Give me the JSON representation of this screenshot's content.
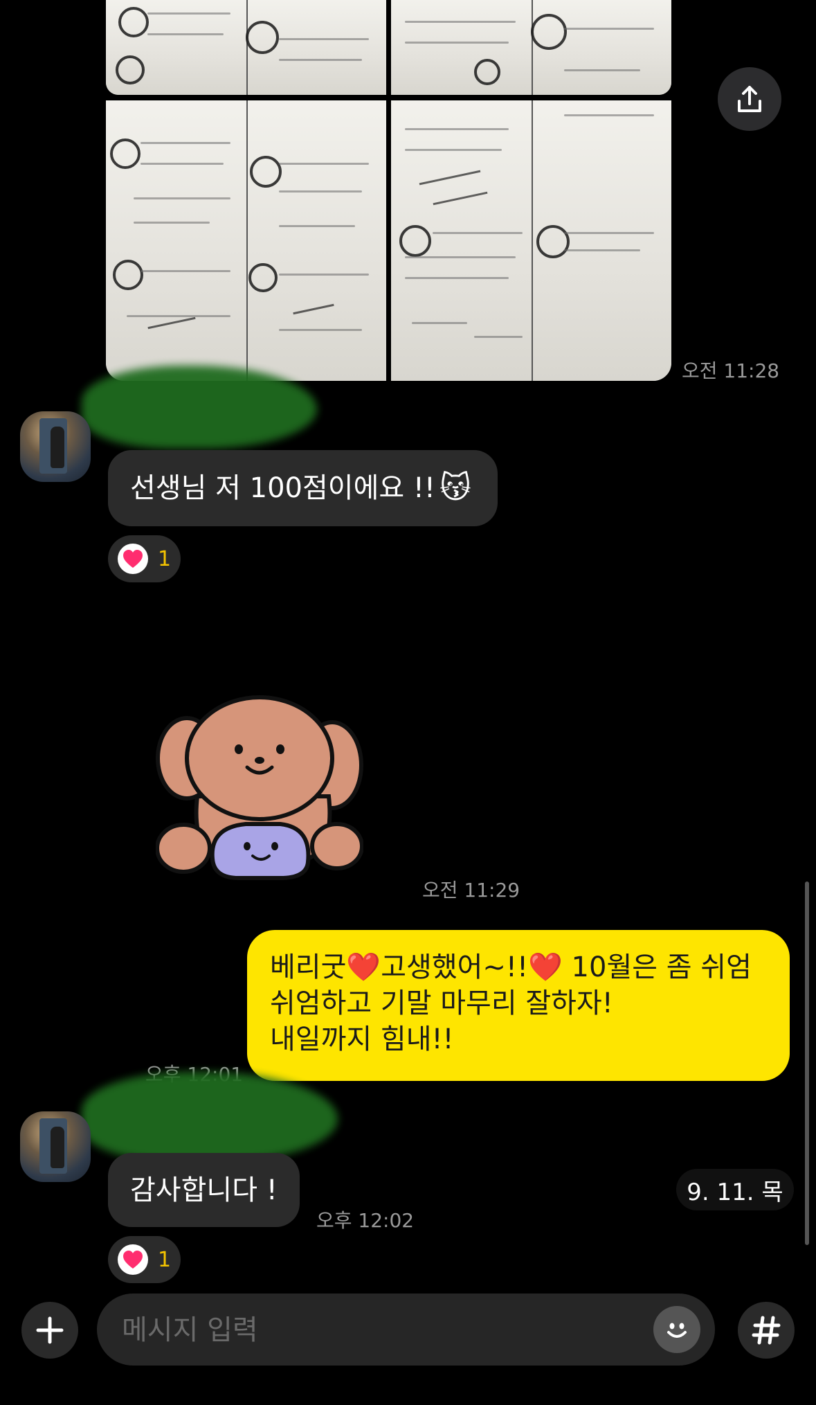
{
  "chat": {
    "messages": [
      {
        "type": "photos",
        "time": "오전 11:28"
      },
      {
        "type": "text",
        "from": "other",
        "text": "선생님 저 100점이에요 !!",
        "emoji": "😽",
        "reaction_count": "1"
      },
      {
        "type": "sticker",
        "from": "other",
        "time": "오전 11:29"
      },
      {
        "type": "text",
        "from": "me",
        "lines": [
          {
            "a": "베리굿",
            "heart1": "❤️",
            "b": "고생했어~!!",
            "heart2": "❤️",
            "c": " 10월은 좀 쉬엄"
          },
          "쉬엄하고 기말 마무리 잘하자!",
          "내일까지 힘내!!"
        ],
        "time": "오후 12:01"
      },
      {
        "type": "text",
        "from": "other",
        "text": "감사합니다 !",
        "time": "오후 12:02",
        "reaction_count": "1"
      }
    ],
    "date_chip": "9. 11. 목"
  },
  "composer": {
    "placeholder": "메시지 입력"
  },
  "icons": {
    "share": "share-icon",
    "plus": "plus-icon",
    "emoji": "emoji-icon",
    "hash": "hash-icon",
    "heart": "heart-icon"
  },
  "colors": {
    "my_bubble": "#fee500",
    "other_bubble": "#2b2b2b",
    "reaction_heart": "#ff2d6f",
    "reaction_count": "#f5c400"
  }
}
